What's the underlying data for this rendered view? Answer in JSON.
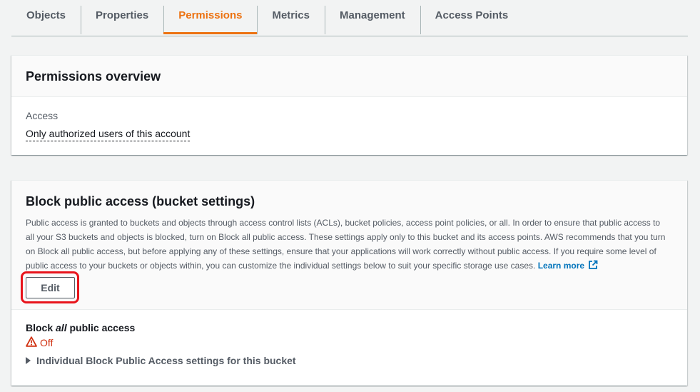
{
  "tabs": [
    {
      "label": "Objects"
    },
    {
      "label": "Properties"
    },
    {
      "label": "Permissions"
    },
    {
      "label": "Metrics"
    },
    {
      "label": "Management"
    },
    {
      "label": "Access Points"
    }
  ],
  "active_tab": "Permissions",
  "permissions_overview": {
    "title": "Permissions overview",
    "access_label": "Access",
    "access_value": "Only authorized users of this account"
  },
  "block_public_access": {
    "title": "Block public access (bucket settings)",
    "description": "Public access is granted to buckets and objects through access control lists (ACLs), bucket policies, access point policies, or all. In order to ensure that public access to all your S3 buckets and objects is blocked, turn on Block all public access. These settings apply only to this bucket and its access points. AWS recommends that you turn on Block all public access, but before applying any of these settings, ensure that your applications will work correctly without public access. If you require some level of public access to your buckets or objects within, you can customize the individual settings below to suit your specific storage use cases.",
    "learn_more": "Learn more",
    "edit_label": "Edit",
    "block_all_prefix": "Block ",
    "block_all_emphasis": "all",
    "block_all_suffix": " public access",
    "status": "Off",
    "expander_label": "Individual Block Public Access settings for this bucket"
  },
  "colors": {
    "accent": "#ec7211",
    "link": "#0073bb",
    "error": "#d13212",
    "highlight": "#e8141c"
  },
  "icons": [
    "external-link-icon",
    "warning-icon",
    "caret-right-icon"
  ]
}
